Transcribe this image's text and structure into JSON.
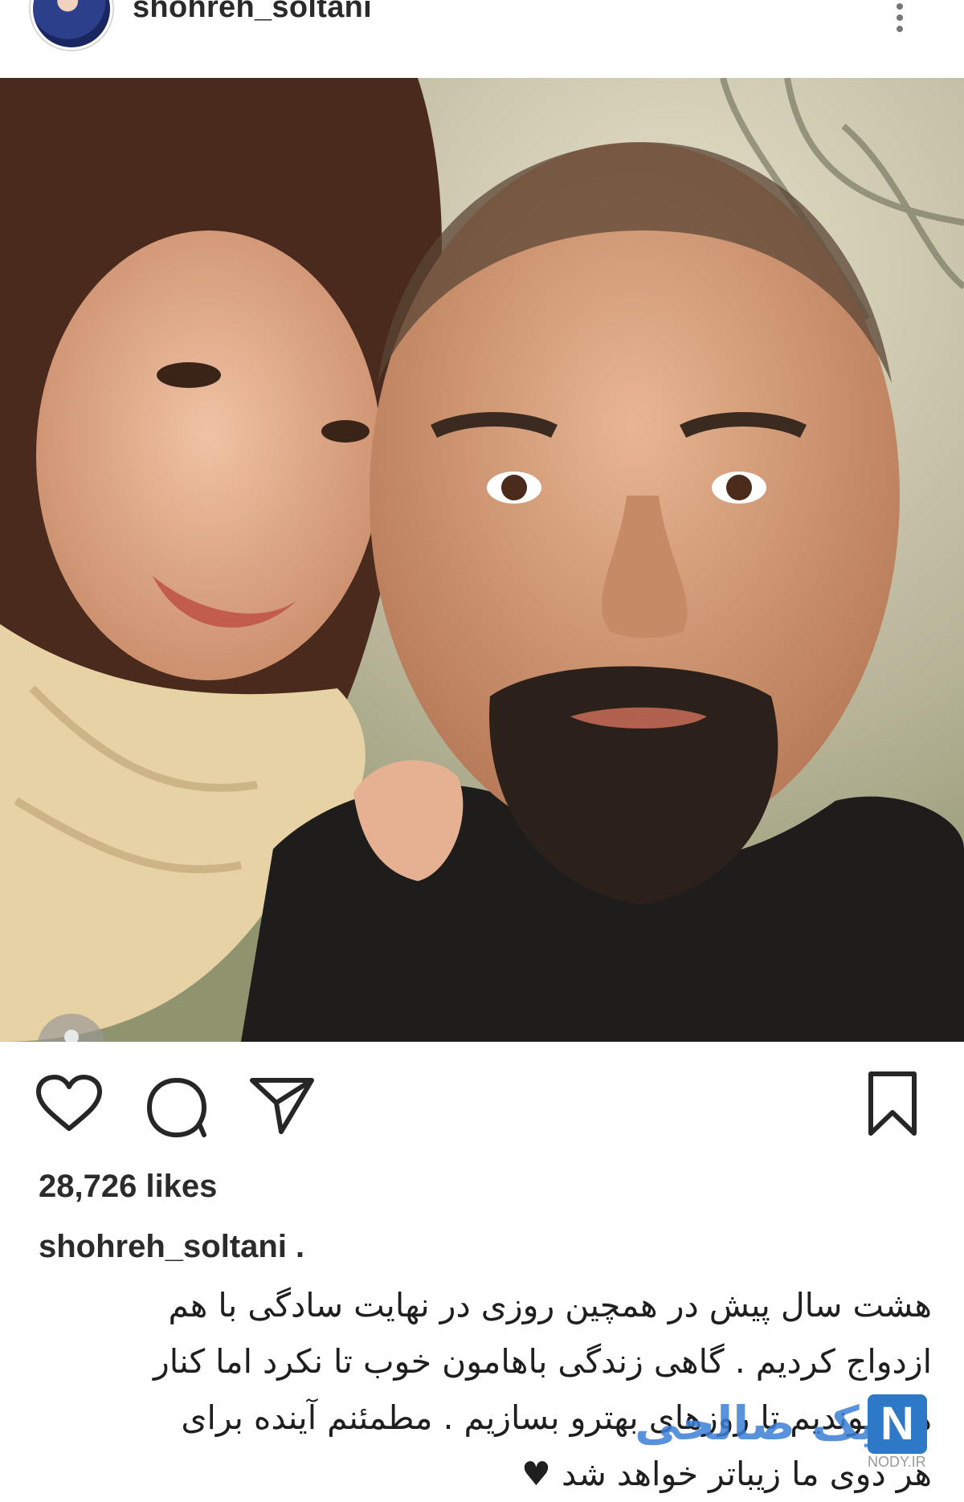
{
  "header": {
    "username": "shohreh_soltani",
    "avatar_icon": "profile-avatar",
    "more_icon": "more-vertical-icon"
  },
  "post": {
    "photo_alt_icon": "tag-people-icon",
    "likes": "28,726 likes",
    "caption_username": "shohreh_soltani .",
    "caption_lines": [
      "هشت سال پیش در  همچین روزی در نهایت سادگی با هم",
      "ازدواج کردیم . گاهی زندگی باهامون خوب تا نکرد اما کنار",
      "هم موندیم تا روزهای بهترو بسازیم . مطمئنم آینده  برای",
      "هر دوی ما زیباتر خواهد شد ♥"
    ]
  },
  "actions": {
    "like_icon": "heart-icon",
    "comment_icon": "comment-icon",
    "share_icon": "send-icon",
    "save_icon": "bookmark-icon"
  },
  "watermark": {
    "text": "نیک صالحی",
    "logo": "N",
    "site": "NODY.IR"
  },
  "colors": {
    "text": "#262626",
    "watermark_blue": "#3d7fd6"
  }
}
